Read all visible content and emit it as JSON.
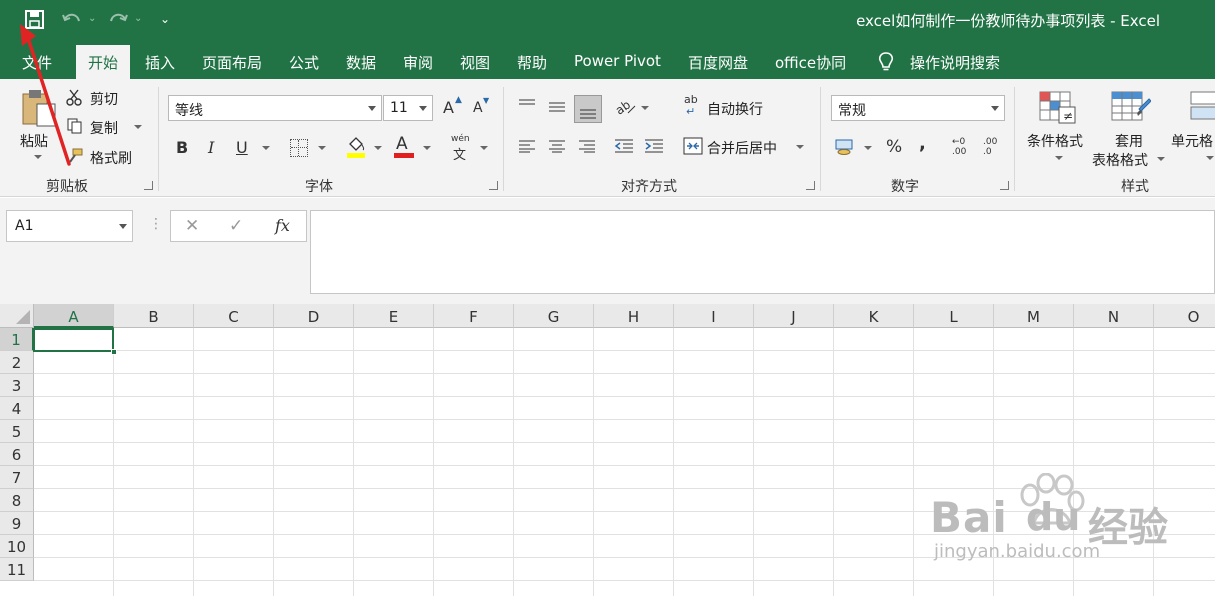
{
  "window": {
    "title": "excel如何制作一份教师待办事项列表  -  Excel"
  },
  "tabs": [
    {
      "label": "文件"
    },
    {
      "label": "开始"
    },
    {
      "label": "插入"
    },
    {
      "label": "页面布局"
    },
    {
      "label": "公式"
    },
    {
      "label": "数据"
    },
    {
      "label": "审阅"
    },
    {
      "label": "视图"
    },
    {
      "label": "帮助"
    },
    {
      "label": "Power Pivot"
    },
    {
      "label": "百度网盘"
    },
    {
      "label": "office协同"
    },
    {
      "label": "操作说明搜索"
    }
  ],
  "ribbon": {
    "clipboard": {
      "group": "剪贴板",
      "paste": "粘贴",
      "cut": "剪切",
      "copy": "复制",
      "format_painter": "格式刷"
    },
    "font": {
      "group": "字体",
      "font_name": "等线",
      "font_size": "11",
      "bold": "B",
      "italic": "I",
      "underline": "U",
      "grow": "A",
      "shrink": "A",
      "phonetic_top": "wén",
      "phonetic_bottom": "文",
      "font_color_letter": "A"
    },
    "alignment": {
      "group": "对齐方式",
      "wrap_text": "自动换行",
      "merge_center": "合并后居中",
      "wrap_icon": "ab"
    },
    "number": {
      "group": "数字",
      "format": "常规",
      "percent": "%",
      "comma": ",",
      "inc_dec": ".00",
      "dec_dec": ".0"
    },
    "styles": {
      "group": "样式",
      "conditional": "条件格式",
      "table_format_1": "套用",
      "table_format_2": "表格格式",
      "cell_styles": "单元格"
    }
  },
  "formula_bar": {
    "name_box": "A1",
    "fx": "fx",
    "value": ""
  },
  "sheet": {
    "columns": [
      "A",
      "B",
      "C",
      "D",
      "E",
      "F",
      "G",
      "H",
      "I",
      "J",
      "K",
      "L",
      "M",
      "N",
      "O"
    ],
    "rows": [
      "1",
      "2",
      "3",
      "4",
      "5",
      "6",
      "7",
      "8",
      "9",
      "10",
      "11"
    ],
    "selected_cell": "A1"
  },
  "watermark": {
    "brand_1": "Bai",
    "brand_2": "du",
    "product": "经验",
    "url": "jingyan.baidu.com"
  },
  "colors": {
    "excel_green": "#217346",
    "annotation_red": "#e02424"
  }
}
